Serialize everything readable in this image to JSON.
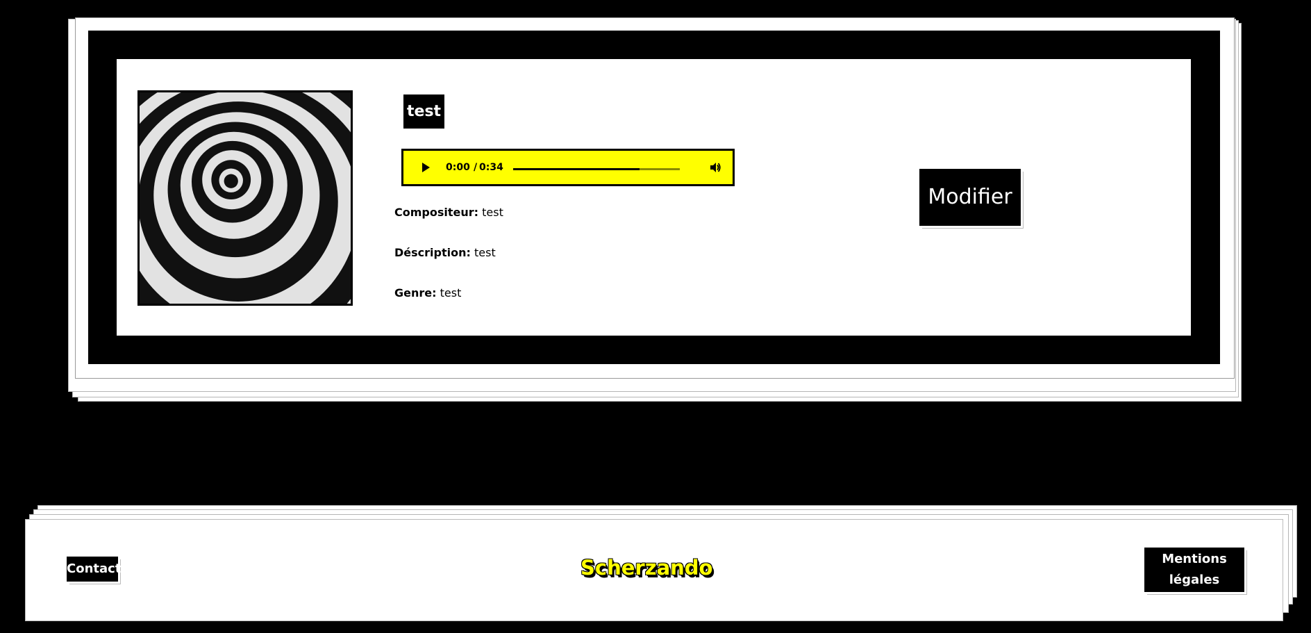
{
  "song": {
    "title": "test",
    "player": {
      "current_time": "0:00",
      "separator": "/",
      "duration": "0:34",
      "progress_fraction": 0.76,
      "accent_color": "#ffff00"
    },
    "composer_label": "Compositeur:",
    "composer": "test",
    "description_label": "Déscription:",
    "description": "test",
    "genre_label": "Genre:",
    "genre": "test",
    "edit_label": "Modifier"
  },
  "footer": {
    "contact_label": "Contact",
    "brand": "Scherzando",
    "legal_line1": "Mentions",
    "legal_line2": "légales"
  }
}
